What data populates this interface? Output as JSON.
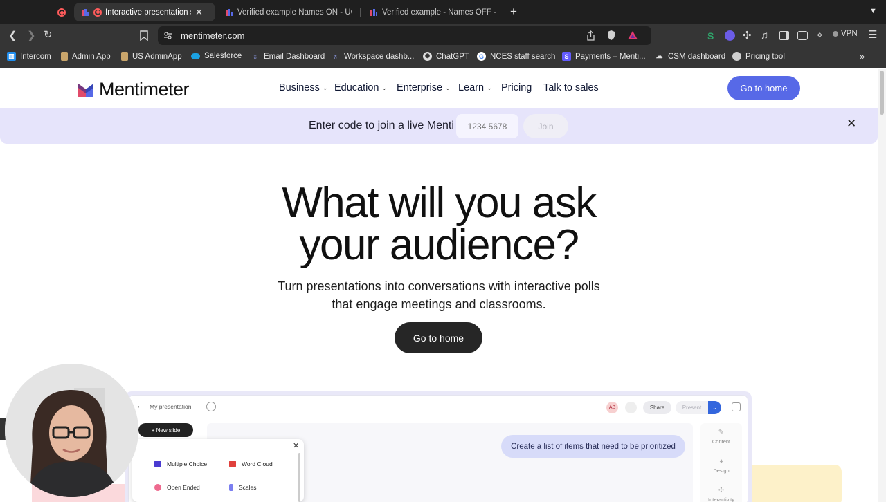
{
  "browser": {
    "tabs": [
      {
        "label": "Interactive presentation so",
        "active": true,
        "recording": true
      },
      {
        "label": "Verified example Names ON - UC",
        "active": false
      },
      {
        "label": "Verified example - Names OFF - U",
        "active": false
      }
    ],
    "url": "mentimeter.com",
    "vpn_label": "VPN",
    "bookmarks": [
      {
        "label": "Intercom",
        "icon": "intercom-icon",
        "color": "#1f8ded"
      },
      {
        "label": "Admin App",
        "icon": "doc-icon",
        "color": "#c9a56b"
      },
      {
        "label": "US AdminApp",
        "icon": "doc-icon",
        "color": "#c9a56b"
      },
      {
        "label": "Salesforce",
        "icon": "cloud-icon",
        "color": "#1ba1e2"
      },
      {
        "label": "Email Dashboard",
        "icon": "drop-icon",
        "color": "#7b8cf0"
      },
      {
        "label": "Workspace dashb...",
        "icon": "drop-icon",
        "color": "#7b8cf0"
      },
      {
        "label": "ChatGPT",
        "icon": "chatgpt-icon",
        "color": "#dcdcdc"
      },
      {
        "label": "NCES staff search",
        "icon": "google-icon",
        "color": "#ffffff"
      },
      {
        "label": "Payments – Menti...",
        "icon": "stripe-icon",
        "color": "#635bff"
      },
      {
        "label": "CSM dashboard",
        "icon": "cloud-icon",
        "color": "#e0e0e0"
      },
      {
        "label": "Pricing tool",
        "icon": "globe-icon",
        "color": "#cfcfcf"
      }
    ]
  },
  "site": {
    "logo_text": "Mentimeter",
    "nav": [
      {
        "label": "Business",
        "dropdown": true
      },
      {
        "label": "Education",
        "dropdown": true
      },
      {
        "label": "Enterprise",
        "dropdown": true
      },
      {
        "label": "Learn",
        "dropdown": true
      },
      {
        "label": "Pricing",
        "dropdown": false
      },
      {
        "label": "Talk to sales",
        "dropdown": false
      }
    ],
    "go_home_label": "Go to home",
    "accent_color": "#5769e7"
  },
  "banner": {
    "text": "Enter code to join a live Menti",
    "code_placeholder": "1234 5678",
    "join_label": "Join"
  },
  "hero": {
    "title_line1": "What will you ask",
    "title_line2": "your audience?",
    "subtitle_line1": "Turn presentations into conversations with interactive polls",
    "subtitle_line2": "that engage meetings and classrooms.",
    "cta_label": "Go to home"
  },
  "preview": {
    "presentation_title": "My presentation",
    "avatar_initials": "AB",
    "share_label": "Share",
    "present_label": "Present",
    "new_slide_label": "+ New slide",
    "prompt_text": "Create a list of items that need to be prioritized",
    "side_panel": [
      "Content",
      "Design",
      "Interactivity"
    ],
    "slide_types": [
      {
        "label": "Multiple Choice",
        "color": "#4a3bd1"
      },
      {
        "label": "Word Cloud",
        "color": "#e0403c"
      },
      {
        "label": "Open Ended",
        "color": "#ee6a8f"
      },
      {
        "label": "Scales",
        "color": "#7b7ff0"
      }
    ]
  }
}
